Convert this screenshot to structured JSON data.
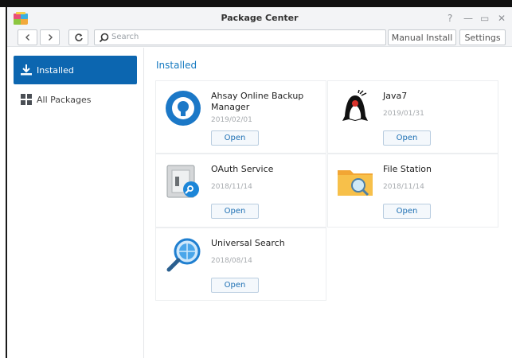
{
  "window": {
    "title": "Package Center",
    "controls": {
      "help": "?",
      "minimize": "—",
      "maximize": "▭",
      "close": "✕"
    }
  },
  "toolbar": {
    "back_icon": "chevron-left",
    "forward_icon": "chevron-right",
    "refresh_icon": "refresh",
    "search_placeholder": "Search",
    "manual_install_label": "Manual Install",
    "settings_label": "Settings"
  },
  "sidebar": {
    "items": [
      {
        "label": "Installed",
        "icon": "download-icon",
        "active": true
      },
      {
        "label": "All Packages",
        "icon": "grid-icon",
        "active": false
      }
    ]
  },
  "main": {
    "section_title": "Installed",
    "open_label": "Open",
    "packages": [
      {
        "name": "Ahsay Online Backup Manager",
        "date": "2019/02/01",
        "icon": "ahsay-icon"
      },
      {
        "name": "Java7",
        "date": "2019/01/31",
        "icon": "java-duke-icon"
      },
      {
        "name": "OAuth Service",
        "date": "2018/11/14",
        "icon": "oauth-icon"
      },
      {
        "name": "File Station",
        "date": "2018/11/14",
        "icon": "folder-search-icon"
      },
      {
        "name": "Universal Search",
        "date": "2018/08/14",
        "icon": "magnifier-icon"
      }
    ]
  },
  "colors": {
    "accent": "#0c66b0",
    "link": "#1479c0",
    "titlebar_bg": "#f3f4f6"
  }
}
